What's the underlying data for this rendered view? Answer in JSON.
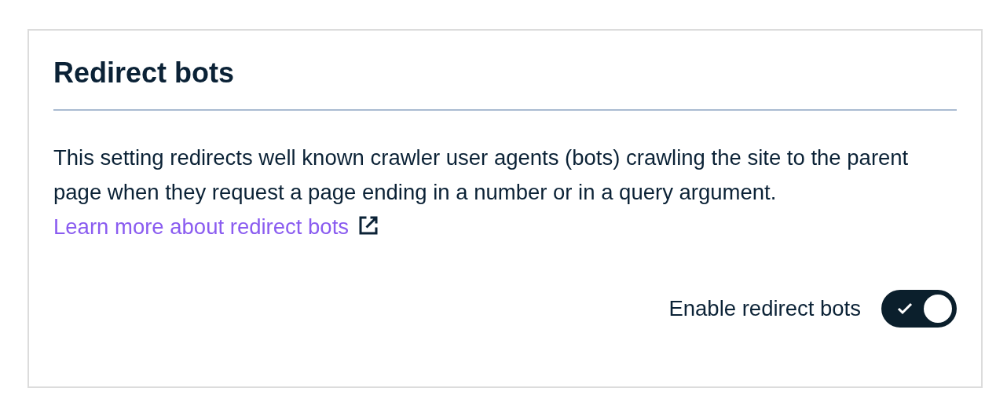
{
  "card": {
    "title": "Redirect bots",
    "description": "This setting redirects well known crawler user agents (bots) crawling the site to the parent page when they request a page ending in a number or in a query argument.",
    "link": "Learn more about redirect bots",
    "toggle": {
      "label": "Enable redirect bots",
      "on": true
    }
  }
}
